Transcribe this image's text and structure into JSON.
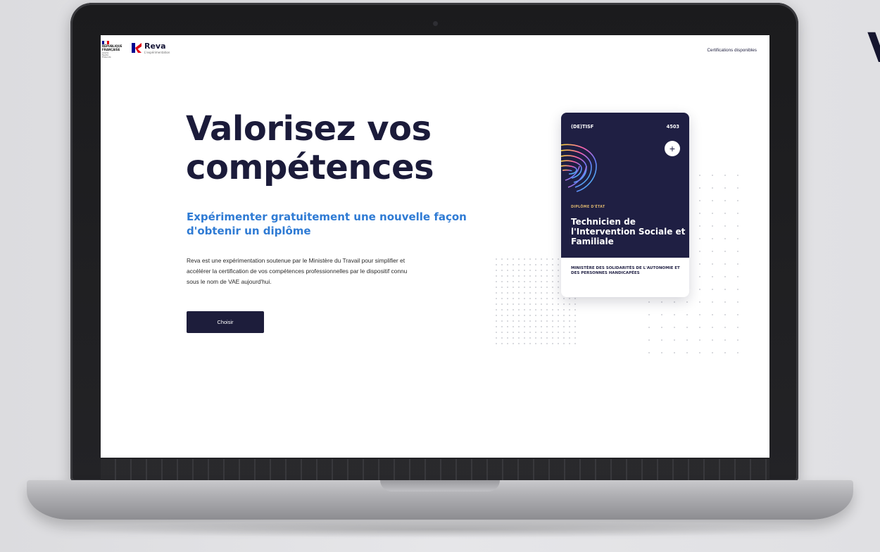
{
  "edge_letter": "V",
  "header": {
    "gov_logo": {
      "line1": "RÉPUBLIQUE",
      "line2": "FRANÇAISE",
      "motto": [
        "Liberté",
        "Égalité",
        "Fraternité"
      ]
    },
    "brand_name": "Reva",
    "brand_sub": "L'expérimentation",
    "nav_link": "Certifications disponibles"
  },
  "hero": {
    "title_line1": "Valorisez vos",
    "title_line2": "compétences",
    "subtitle": "Expérimenter gratuitement une nouvelle façon d'obtenir un diplôme",
    "body": "Reva est une expérimentation soutenue par le Ministère du Travail pour simplifier et accélérer la certification de vos compétences professionnelles par le dispositif connu sous le nom de VAE aujourd'hui.",
    "cta_label": "Choisir"
  },
  "card": {
    "code": "(DE)TISF",
    "number": "4503",
    "add_icon": "plus-icon",
    "add_symbol": "+",
    "kicker": "DIPLÔME D'ÉTAT",
    "title": "Technicien de l'Intervention Sociale et Familiale",
    "organization": "MINISTÈRE DES SOLIDARITÉS DE L'AUTONOMIE ET DES PERSONNES HANDICAPÉES"
  },
  "colors": {
    "navy": "#1f1f43",
    "accent_blue": "#2f7bd4",
    "kicker_gold": "#d8b26d",
    "flag_blue": "#000091",
    "flag_red": "#e1000f",
    "reva_red": "#e1000f"
  }
}
